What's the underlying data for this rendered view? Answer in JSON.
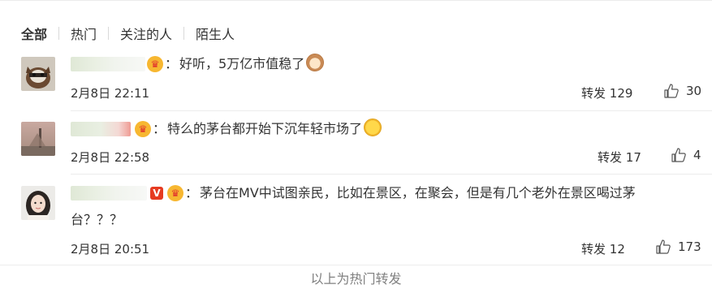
{
  "tabs": [
    {
      "label": "全部",
      "active": true
    },
    {
      "label": "热门",
      "active": false
    },
    {
      "label": "关注的人",
      "active": false
    },
    {
      "label": "陌生人",
      "active": false
    }
  ],
  "comments": [
    {
      "text": "好听，5万亿市值稳了",
      "emoji": "monkey-face-emoji",
      "time": "2月8日 22:11",
      "repost_label": "转发",
      "repost_count": "129",
      "like_count": "30"
    },
    {
      "text": "特么的茅台都开始下沉年轻市场了",
      "emoji": "laughing-tears-emoji",
      "time": "2月8日 22:58",
      "repost_label": "转发",
      "repost_count": "17",
      "like_count": "4"
    },
    {
      "text_line1": "茅台在MV中试图亲民，比如在景区，在聚会，但是有几个老外在景区喝过茅",
      "text_line2": "台？？？",
      "time": "2月8日 20:51",
      "repost_label": "转发",
      "repost_count": "12",
      "like_count": "173"
    }
  ],
  "footer": "以上为热门转发",
  "colors": {
    "text": "#333333",
    "muted": "#808080",
    "divider": "#ececec",
    "fan_badge": "#f7b731",
    "verified_badge": "#e63b21"
  },
  "icons": [
    "fan-badge-icon",
    "verified-v-icon",
    "thumbs-up-icon"
  ]
}
